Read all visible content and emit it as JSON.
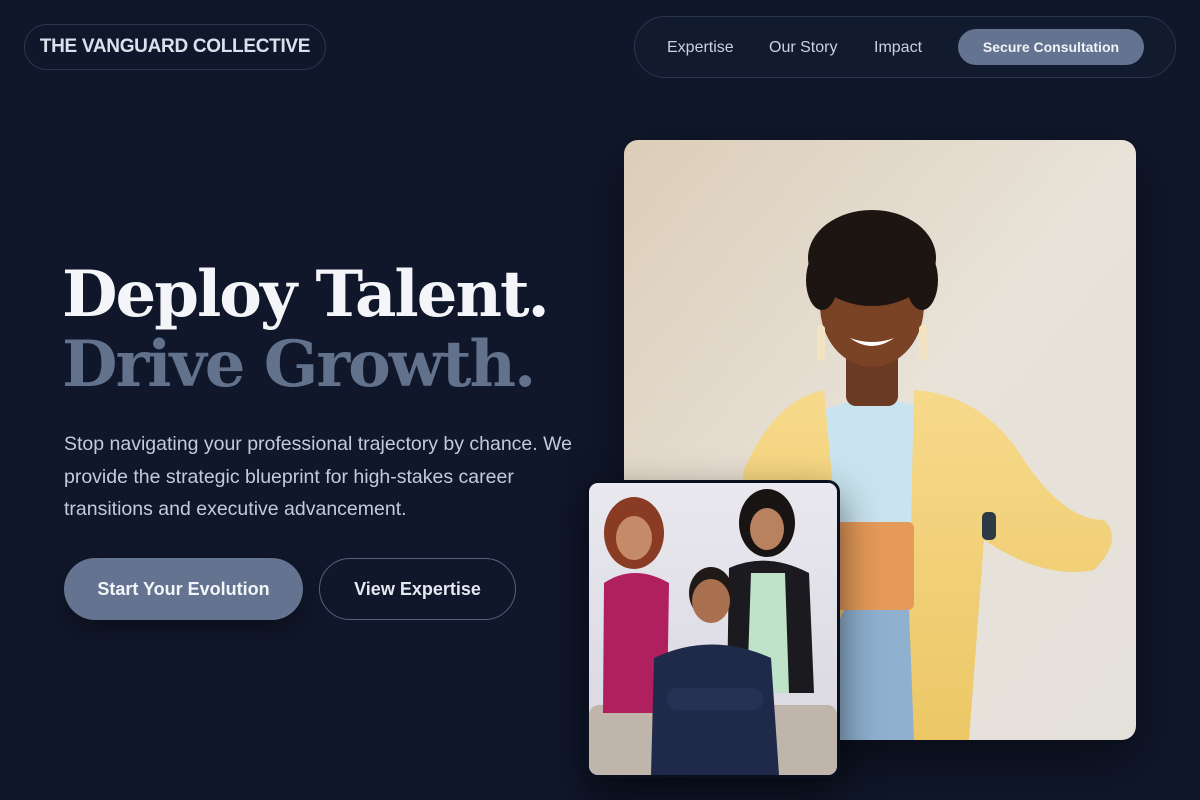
{
  "brand": {
    "name": "THE VANGUARD COLLECTIVE"
  },
  "nav": {
    "links": [
      "Expertise",
      "Our Story",
      "Impact"
    ],
    "cta": "Secure Consultation"
  },
  "hero": {
    "headline_line1": "Deploy Talent.",
    "headline_line2": "Drive Growth.",
    "description": "Stop navigating your professional trajectory by chance. We provide the strategic blueprint for high-stakes career transitions and executive advancement.",
    "primary_button": "Start Your Evolution",
    "secondary_button": "View Expertise"
  },
  "images": {
    "main_photo": "portrait-photo",
    "team_photo": "team-photo"
  },
  "colors": {
    "background": "#10172a",
    "accent": "#64738f",
    "muted_headline": "#62718c"
  }
}
